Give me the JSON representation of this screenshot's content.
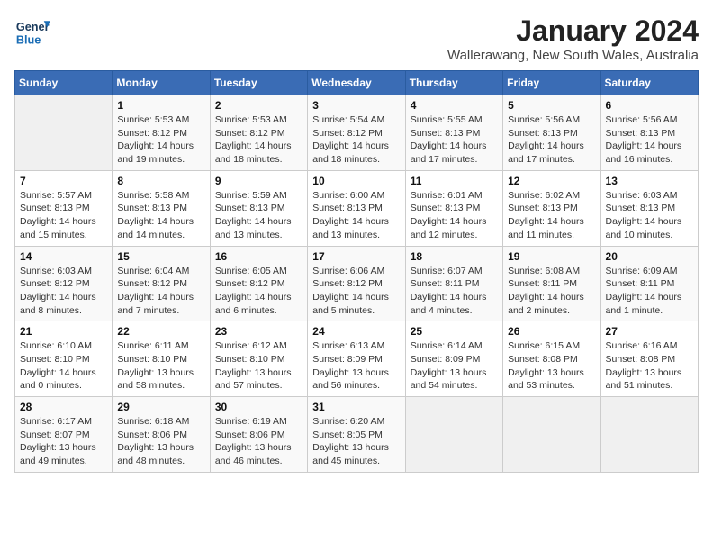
{
  "logo": {
    "general": "General",
    "blue": "Blue"
  },
  "header": {
    "month": "January 2024",
    "location": "Wallerawang, New South Wales, Australia"
  },
  "weekdays": [
    "Sunday",
    "Monday",
    "Tuesday",
    "Wednesday",
    "Thursday",
    "Friday",
    "Saturday"
  ],
  "weeks": [
    [
      {
        "day": "",
        "info": ""
      },
      {
        "day": "1",
        "info": "Sunrise: 5:53 AM\nSunset: 8:12 PM\nDaylight: 14 hours\nand 19 minutes."
      },
      {
        "day": "2",
        "info": "Sunrise: 5:53 AM\nSunset: 8:12 PM\nDaylight: 14 hours\nand 18 minutes."
      },
      {
        "day": "3",
        "info": "Sunrise: 5:54 AM\nSunset: 8:12 PM\nDaylight: 14 hours\nand 18 minutes."
      },
      {
        "day": "4",
        "info": "Sunrise: 5:55 AM\nSunset: 8:13 PM\nDaylight: 14 hours\nand 17 minutes."
      },
      {
        "day": "5",
        "info": "Sunrise: 5:56 AM\nSunset: 8:13 PM\nDaylight: 14 hours\nand 17 minutes."
      },
      {
        "day": "6",
        "info": "Sunrise: 5:56 AM\nSunset: 8:13 PM\nDaylight: 14 hours\nand 16 minutes."
      }
    ],
    [
      {
        "day": "7",
        "info": "Sunrise: 5:57 AM\nSunset: 8:13 PM\nDaylight: 14 hours\nand 15 minutes."
      },
      {
        "day": "8",
        "info": "Sunrise: 5:58 AM\nSunset: 8:13 PM\nDaylight: 14 hours\nand 14 minutes."
      },
      {
        "day": "9",
        "info": "Sunrise: 5:59 AM\nSunset: 8:13 PM\nDaylight: 14 hours\nand 13 minutes."
      },
      {
        "day": "10",
        "info": "Sunrise: 6:00 AM\nSunset: 8:13 PM\nDaylight: 14 hours\nand 13 minutes."
      },
      {
        "day": "11",
        "info": "Sunrise: 6:01 AM\nSunset: 8:13 PM\nDaylight: 14 hours\nand 12 minutes."
      },
      {
        "day": "12",
        "info": "Sunrise: 6:02 AM\nSunset: 8:13 PM\nDaylight: 14 hours\nand 11 minutes."
      },
      {
        "day": "13",
        "info": "Sunrise: 6:03 AM\nSunset: 8:13 PM\nDaylight: 14 hours\nand 10 minutes."
      }
    ],
    [
      {
        "day": "14",
        "info": "Sunrise: 6:03 AM\nSunset: 8:12 PM\nDaylight: 14 hours\nand 8 minutes."
      },
      {
        "day": "15",
        "info": "Sunrise: 6:04 AM\nSunset: 8:12 PM\nDaylight: 14 hours\nand 7 minutes."
      },
      {
        "day": "16",
        "info": "Sunrise: 6:05 AM\nSunset: 8:12 PM\nDaylight: 14 hours\nand 6 minutes."
      },
      {
        "day": "17",
        "info": "Sunrise: 6:06 AM\nSunset: 8:12 PM\nDaylight: 14 hours\nand 5 minutes."
      },
      {
        "day": "18",
        "info": "Sunrise: 6:07 AM\nSunset: 8:11 PM\nDaylight: 14 hours\nand 4 minutes."
      },
      {
        "day": "19",
        "info": "Sunrise: 6:08 AM\nSunset: 8:11 PM\nDaylight: 14 hours\nand 2 minutes."
      },
      {
        "day": "20",
        "info": "Sunrise: 6:09 AM\nSunset: 8:11 PM\nDaylight: 14 hours\nand 1 minute."
      }
    ],
    [
      {
        "day": "21",
        "info": "Sunrise: 6:10 AM\nSunset: 8:10 PM\nDaylight: 14 hours\nand 0 minutes."
      },
      {
        "day": "22",
        "info": "Sunrise: 6:11 AM\nSunset: 8:10 PM\nDaylight: 13 hours\nand 58 minutes."
      },
      {
        "day": "23",
        "info": "Sunrise: 6:12 AM\nSunset: 8:10 PM\nDaylight: 13 hours\nand 57 minutes."
      },
      {
        "day": "24",
        "info": "Sunrise: 6:13 AM\nSunset: 8:09 PM\nDaylight: 13 hours\nand 56 minutes."
      },
      {
        "day": "25",
        "info": "Sunrise: 6:14 AM\nSunset: 8:09 PM\nDaylight: 13 hours\nand 54 minutes."
      },
      {
        "day": "26",
        "info": "Sunrise: 6:15 AM\nSunset: 8:08 PM\nDaylight: 13 hours\nand 53 minutes."
      },
      {
        "day": "27",
        "info": "Sunrise: 6:16 AM\nSunset: 8:08 PM\nDaylight: 13 hours\nand 51 minutes."
      }
    ],
    [
      {
        "day": "28",
        "info": "Sunrise: 6:17 AM\nSunset: 8:07 PM\nDaylight: 13 hours\nand 49 minutes."
      },
      {
        "day": "29",
        "info": "Sunrise: 6:18 AM\nSunset: 8:06 PM\nDaylight: 13 hours\nand 48 minutes."
      },
      {
        "day": "30",
        "info": "Sunrise: 6:19 AM\nSunset: 8:06 PM\nDaylight: 13 hours\nand 46 minutes."
      },
      {
        "day": "31",
        "info": "Sunrise: 6:20 AM\nSunset: 8:05 PM\nDaylight: 13 hours\nand 45 minutes."
      },
      {
        "day": "",
        "info": ""
      },
      {
        "day": "",
        "info": ""
      },
      {
        "day": "",
        "info": ""
      }
    ]
  ]
}
